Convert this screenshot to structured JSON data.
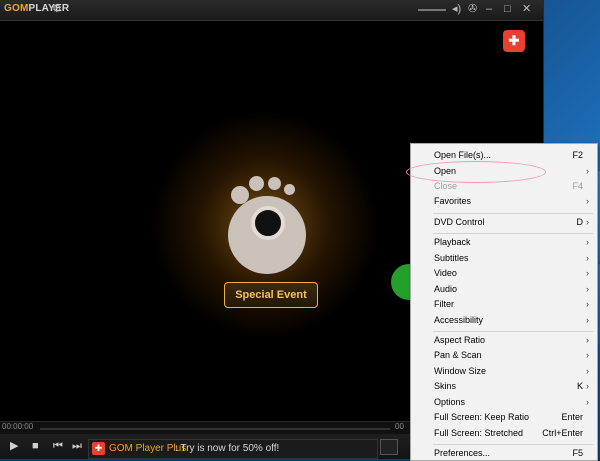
{
  "player": {
    "brand_gom": "GOM",
    "brand_player": "PLAYER",
    "special_event": "Special Event",
    "time_left": "00:00:00",
    "time_right": "00",
    "promo_title": "GOM Player Plus",
    "promo_text": ": Try is now for 50% off!"
  },
  "menu": {
    "items": [
      {
        "label": "Open File(s)...",
        "shortcut": "F2"
      },
      {
        "label": "Open",
        "shortcut": "",
        "submenu": true
      },
      {
        "label": "Close",
        "shortcut": "F4",
        "disabled": true
      },
      {
        "label": "Favorites",
        "shortcut": "",
        "submenu": true
      },
      {
        "label": "DVD Control",
        "shortcut": "D",
        "submenu": true
      },
      {
        "label": "Playback",
        "shortcut": "",
        "submenu": true
      },
      {
        "label": "Subtitles",
        "shortcut": "",
        "submenu": true
      },
      {
        "label": "Video",
        "shortcut": "",
        "submenu": true
      },
      {
        "label": "Audio",
        "shortcut": "",
        "submenu": true
      },
      {
        "label": "Filter",
        "shortcut": "",
        "submenu": true
      },
      {
        "label": "Accessibility",
        "shortcut": "",
        "submenu": true
      },
      {
        "label": "Aspect Ratio",
        "shortcut": "",
        "submenu": true
      },
      {
        "label": "Pan & Scan",
        "shortcut": "",
        "submenu": true
      },
      {
        "label": "Window Size",
        "shortcut": "",
        "submenu": true
      },
      {
        "label": "Skins",
        "shortcut": "K",
        "submenu": true
      },
      {
        "label": "Options",
        "shortcut": "",
        "submenu": true
      },
      {
        "label": "Full Screen: Keep Ratio",
        "shortcut": "Enter"
      },
      {
        "label": "Full Screen: Stretched",
        "shortcut": "Ctrl+Enter"
      },
      {
        "label": "Preferences...",
        "shortcut": "F5"
      }
    ]
  },
  "icons": {
    "gear": "gear-icon",
    "play": "play-icon",
    "stop": "stop-icon",
    "prev": "previous-icon",
    "next": "next-icon"
  },
  "colors": {
    "accent": "#f2a52e",
    "highlight": "#27b12f",
    "annotation": "#f09ab5"
  }
}
